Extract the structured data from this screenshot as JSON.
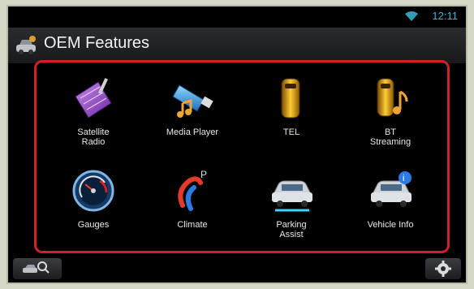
{
  "status": {
    "time": "12:11",
    "wifi_icon": "wifi-icon"
  },
  "header": {
    "title": "OEM Features",
    "icon": "car-settings-icon"
  },
  "features": [
    {
      "label": "Satellite\nRadio",
      "icon": "satellite-dish-icon"
    },
    {
      "label": "Media Player",
      "icon": "usb-music-icon"
    },
    {
      "label": "TEL",
      "icon": "phone-icon"
    },
    {
      "label": "BT\nStreaming",
      "icon": "bluetooth-music-phone-icon"
    },
    {
      "label": "Gauges",
      "icon": "gauge-icon"
    },
    {
      "label": "Climate",
      "icon": "climate-icon"
    },
    {
      "label": "Parking\nAssist",
      "icon": "parking-assist-icon"
    },
    {
      "label": "Vehicle Info",
      "icon": "vehicle-info-icon"
    }
  ],
  "bottom": {
    "left_icon": "car-search-icon",
    "right_icon": "gear-icon"
  },
  "colors": {
    "frame": "#d2202a",
    "clock": "#3fb8d6"
  }
}
